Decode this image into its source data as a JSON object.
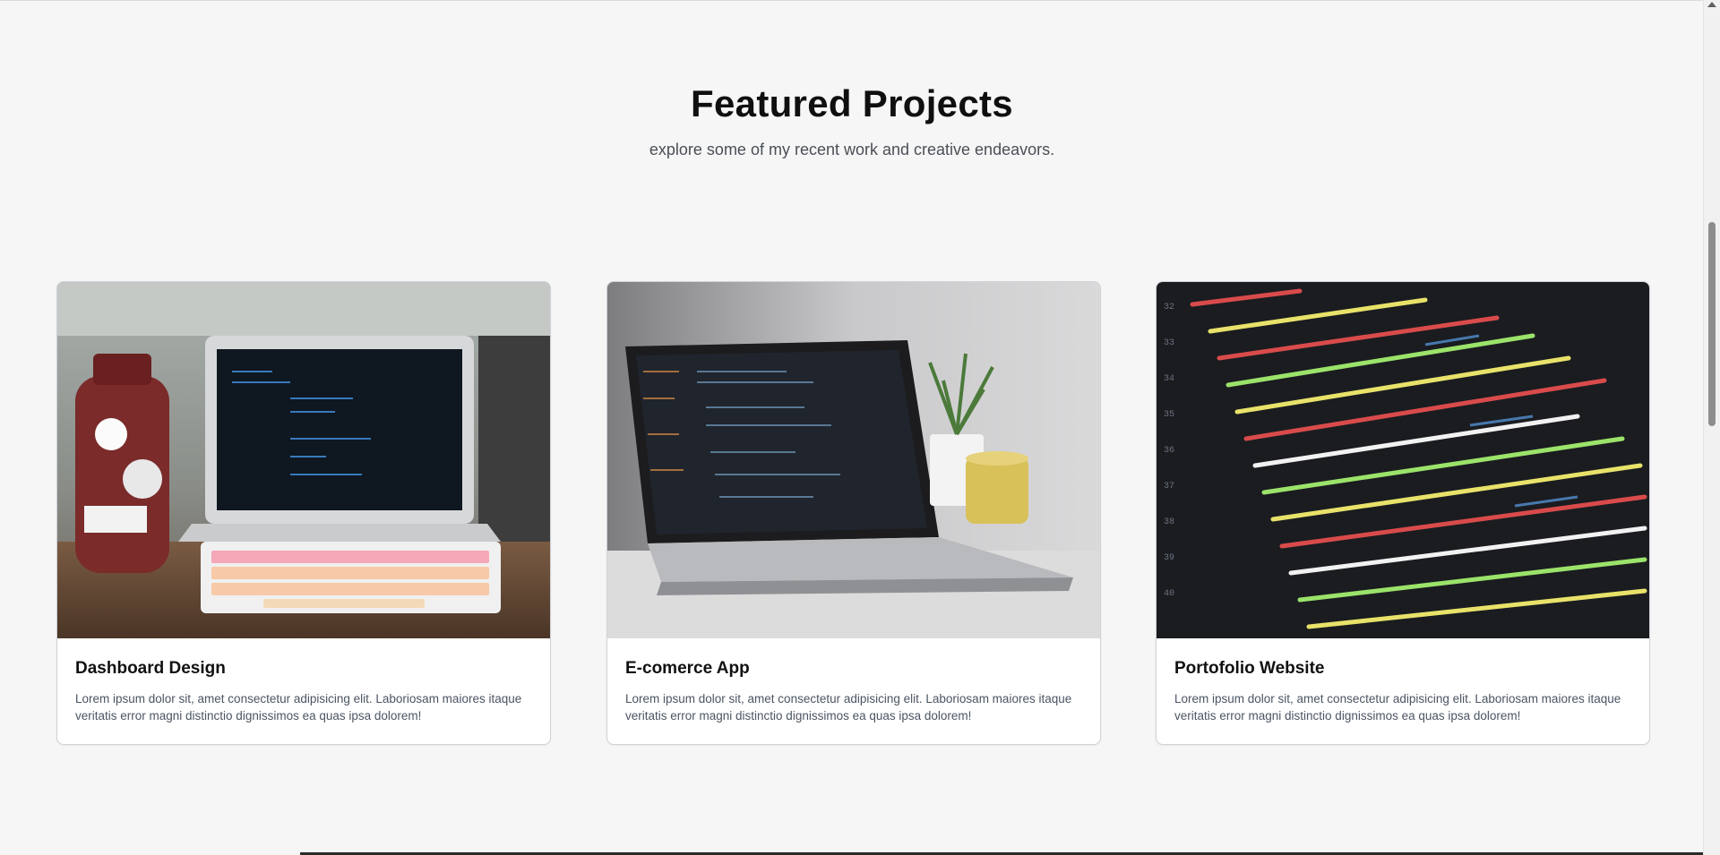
{
  "section": {
    "title": "Featured Projects",
    "subtitle": "explore some of my recent work and creative endeavors."
  },
  "projects": [
    {
      "title": "Dashboard Design",
      "description": "Lorem ipsum dolor sit, amet consectetur adipisicing elit. Laboriosam maiores itaque veritatis error magni distinctio dignissimos ea quas ipsa dolorem!",
      "image": "laptop-with-pink-keyboard-photo"
    },
    {
      "title": "E-comerce App",
      "description": "Lorem ipsum dolor sit, amet consectetur adipisicing elit. Laboriosam maiores itaque veritatis error magni distinctio dignissimos ea quas ipsa dolorem!",
      "image": "macbook-with-plant-and-mug-photo"
    },
    {
      "title": "Portofolio Website",
      "description": "Lorem ipsum dolor sit, amet consectetur adipisicing elit. Laboriosam maiores itaque veritatis error magni distinctio dignissimos ea quas ipsa dolorem!",
      "image": "code-on-screen-photo"
    }
  ],
  "colors": {
    "background": "#f6f6f6",
    "card": "#ffffff",
    "text": "#111111",
    "muted": "#4b5563"
  }
}
